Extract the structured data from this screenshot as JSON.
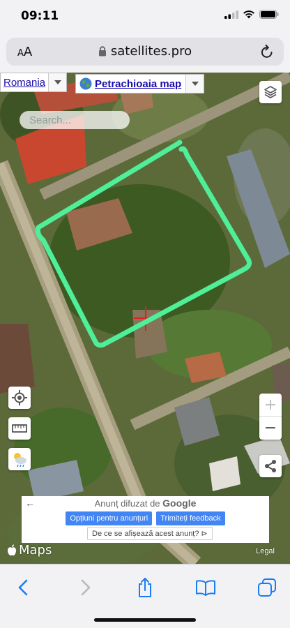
{
  "status": {
    "time": "09:11"
  },
  "browser": {
    "text_size": "AA",
    "domain": "satellites.pro"
  },
  "map": {
    "country_link": "Romania",
    "place_link": "Petrachioaia map",
    "search": {
      "placeholder": "Search..."
    },
    "zoom_in": "+",
    "zoom_out": "−",
    "maps_label": "Maps",
    "legal": "Legal",
    "marker_color": "#4fef9a"
  },
  "ad": {
    "title_prefix": "Anunț difuzat de",
    "title_brand": "Google",
    "options_button": "Opțiuni pentru anunțuri",
    "feedback_button": "Trimiteți feedback",
    "why_link": "De ce se afișează acest anunț?"
  },
  "colors": {
    "accent": "#1a7cf5",
    "link": "#1a0dab",
    "ad_button": "#4285f4"
  }
}
